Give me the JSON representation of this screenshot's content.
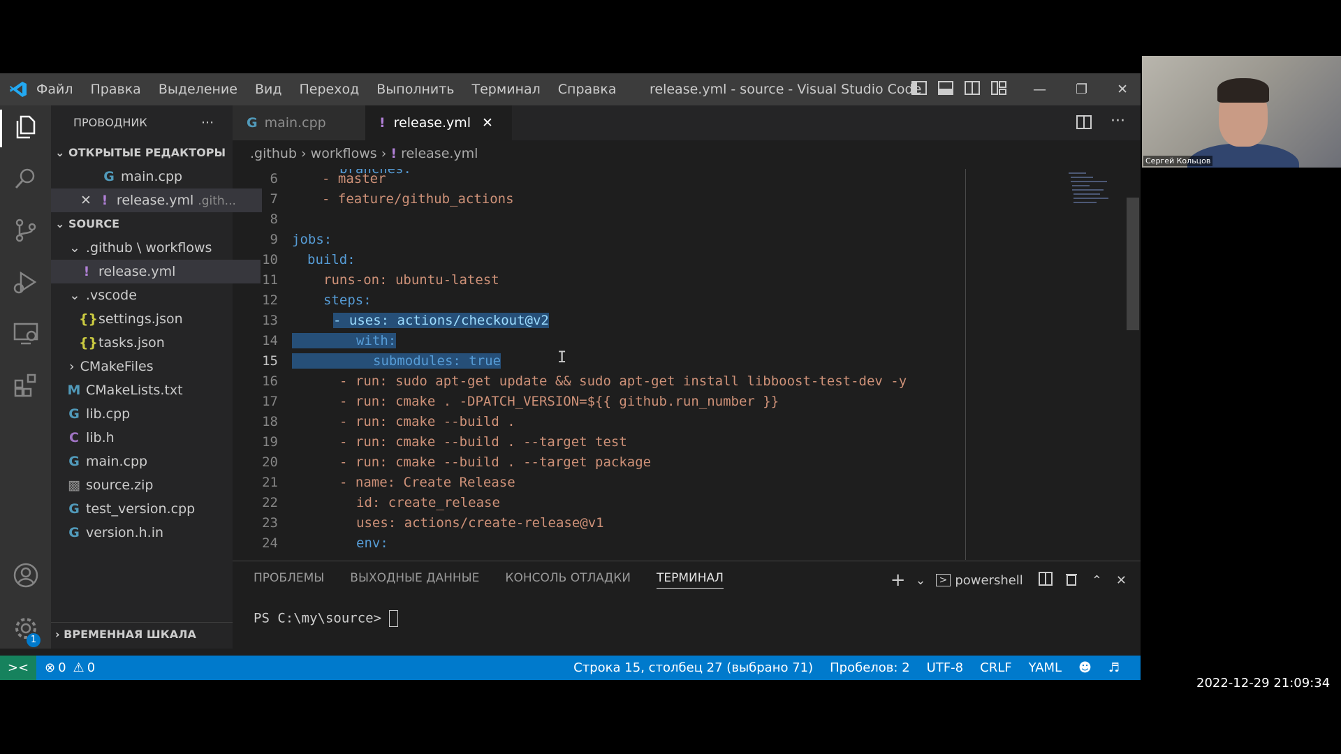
{
  "window_title": "release.yml - source - Visual Studio Code",
  "menu": [
    "Файл",
    "Правка",
    "Выделение",
    "Вид",
    "Переход",
    "Выполнить",
    "Терминал",
    "Справка"
  ],
  "sidebar": {
    "title": "ПРОВОДНИК",
    "open_editors_title": "ОТКРЫТЫЕ РЕДАКТОРЫ",
    "open_editors": [
      {
        "name": "main.cpp"
      },
      {
        "name": "release.yml",
        "path": ".gith..."
      }
    ],
    "folder_title": "SOURCE",
    "tree": [
      {
        "label": ".github \\ workflows"
      },
      {
        "label": "release.yml"
      },
      {
        "label": ".vscode"
      },
      {
        "label": "settings.json"
      },
      {
        "label": "tasks.json"
      },
      {
        "label": "CMakeFiles"
      },
      {
        "label": "CMakeLists.txt"
      },
      {
        "label": "lib.cpp"
      },
      {
        "label": "lib.h"
      },
      {
        "label": "main.cpp"
      },
      {
        "label": "source.zip"
      },
      {
        "label": "test_version.cpp"
      },
      {
        "label": "version.h.in"
      }
    ],
    "timeline_title": "ВРЕМЕННАЯ ШКАЛА"
  },
  "tabs": [
    {
      "label": "main.cpp"
    },
    {
      "label": "release.yml"
    }
  ],
  "breadcrumb": [
    ".github",
    "workflows",
    "release.yml"
  ],
  "code": {
    "partial_top": "branches:",
    "lines": [
      {
        "n": "6",
        "t": "- master"
      },
      {
        "n": "7",
        "t": "- feature/github_actions"
      },
      {
        "n": "8",
        "t": ""
      },
      {
        "n": "9",
        "t": "jobs:"
      },
      {
        "n": "10",
        "t": "build:"
      },
      {
        "n": "11",
        "t": "runs-on: ubuntu-latest"
      },
      {
        "n": "12",
        "t": "steps:"
      },
      {
        "n": "13",
        "t": "- uses: actions/checkout@v2"
      },
      {
        "n": "14",
        "t": "with:"
      },
      {
        "n": "15",
        "t": "submodules: true"
      },
      {
        "n": "16",
        "t": "- run: sudo apt-get update && sudo apt-get install libboost-test-dev -y"
      },
      {
        "n": "17",
        "t": "- run: cmake . -DPATCH_VERSION=${{ github.run_number }}"
      },
      {
        "n": "18",
        "t": "- run: cmake --build ."
      },
      {
        "n": "19",
        "t": "- run: cmake --build . --target test"
      },
      {
        "n": "20",
        "t": "- run: cmake --build . --target package"
      },
      {
        "n": "21",
        "t": "- name: Create Release"
      },
      {
        "n": "22",
        "t": "id: create_release"
      },
      {
        "n": "23",
        "t": "uses: actions/create-release@v1"
      },
      {
        "n": "24",
        "t": "env:"
      }
    ]
  },
  "panel": {
    "tabs": [
      "ПРОБЛЕМЫ",
      "ВЫХОДНЫЕ ДАННЫЕ",
      "КОНСОЛЬ ОТЛАДКИ",
      "ТЕРМИНАЛ"
    ],
    "shell": "powershell",
    "prompt": "PS C:\\my\\source>"
  },
  "status": {
    "errors": "0",
    "warnings": "0",
    "position": "Строка 15, столбец 27 (выбрано 71)",
    "indent": "Пробелов: 2",
    "encoding": "UTF-8",
    "eol": "CRLF",
    "language": "YAML",
    "badge": "1"
  },
  "webcam": {
    "name": "Сергей Кольцов"
  },
  "timestamp": "2022-12-29 21:09:34",
  "colors": {
    "accent": "#007acc",
    "selection": "#264f78",
    "remote": "#16825d"
  }
}
